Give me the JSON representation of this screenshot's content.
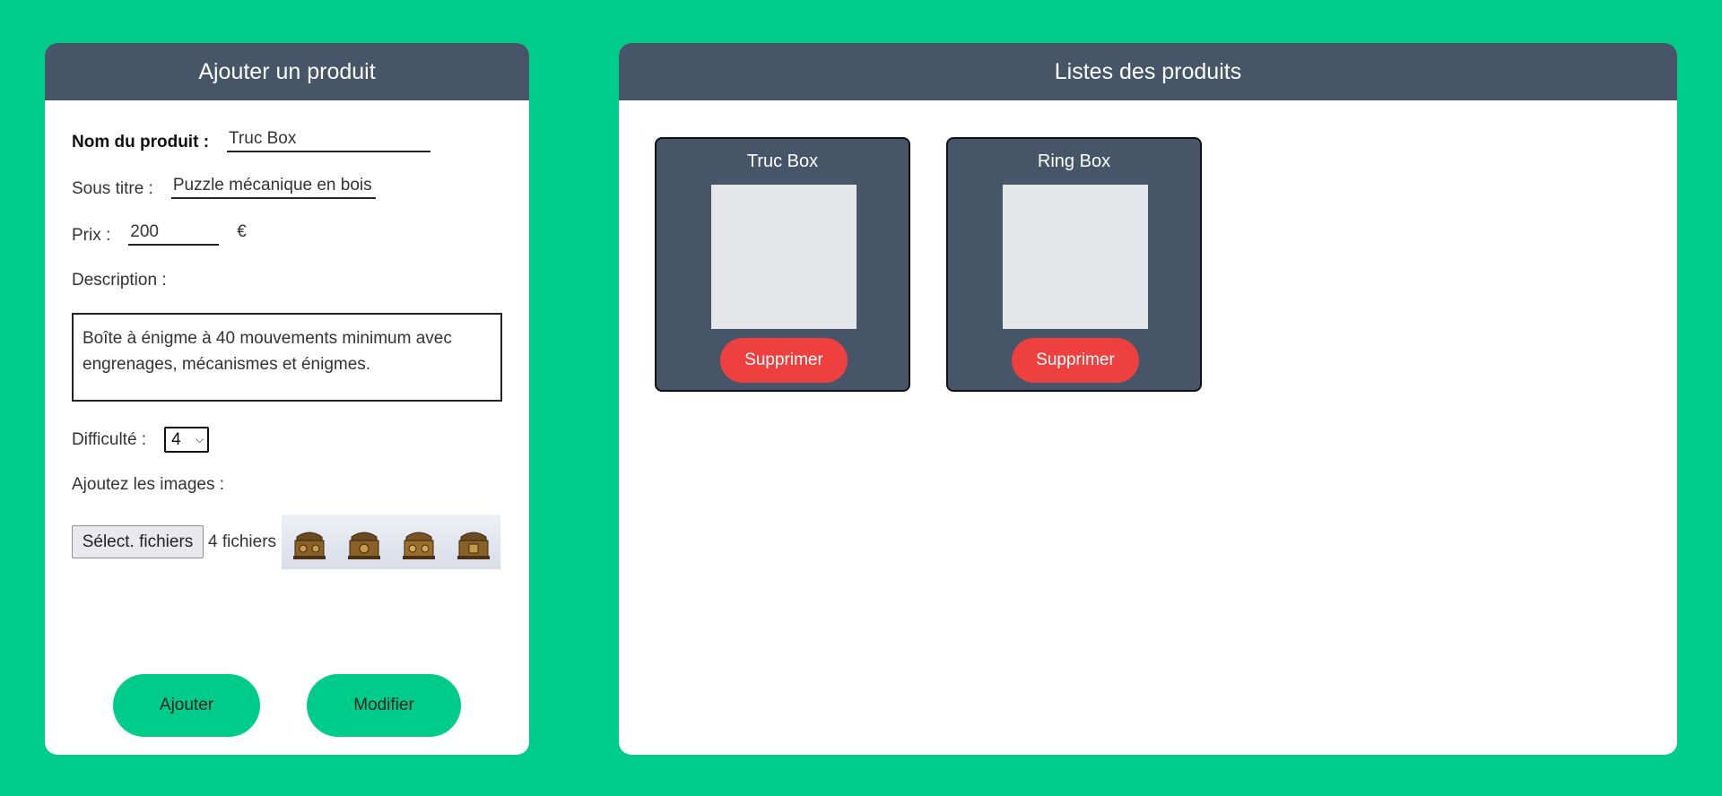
{
  "form": {
    "header": "Ajouter un produit",
    "name_label": "Nom du produit :",
    "name_value": "Truc Box",
    "subtitle_label": "Sous titre :",
    "subtitle_value": "Puzzle mécanique en bois",
    "price_label": "Prix :",
    "price_value": "200",
    "currency": "€",
    "description_label": "Description :",
    "description_value": "Boîte à énigme à 40 mouvements minimum avec engrenages, mécanismes et énigmes.",
    "difficulty_label": "Difficulté :",
    "difficulty_value": "4",
    "images_label": "Ajoutez les images :",
    "file_button": "Sélect. fichiers",
    "file_count": "4 fichiers",
    "thumbnail_icon": "wooden-puzzle-box-icon",
    "add_button": "Ajouter",
    "modify_button": "Modifier"
  },
  "list": {
    "header": "Listes des produits",
    "products": [
      {
        "title": "Truc Box",
        "delete_label": "Supprimer"
      },
      {
        "title": "Ring Box",
        "delete_label": "Supprimer"
      }
    ]
  },
  "colors": {
    "background": "#00cc8a",
    "header": "#465568",
    "delete": "#ef4040",
    "accent": "#00cc8a"
  }
}
